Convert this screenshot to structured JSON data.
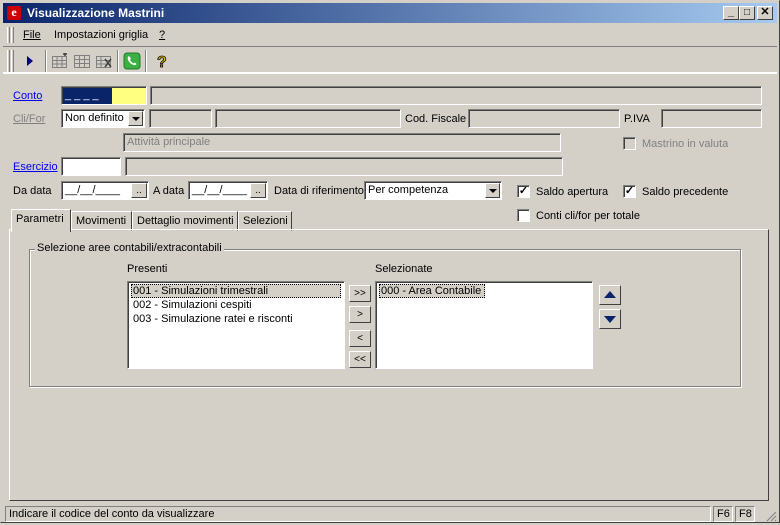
{
  "window": {
    "title": "Visualizzazione Mastrini",
    "app_icon_letter": "e",
    "controls": {
      "minimize": "_",
      "maximize": "□",
      "close": "✕"
    }
  },
  "menu": {
    "items": [
      {
        "label": "File"
      },
      {
        "label": "Impostazioni griglia"
      },
      {
        "label": "?"
      }
    ]
  },
  "toolbar": {
    "icons": [
      "play-icon",
      "grid-add-icon",
      "grid-icon",
      "grid-remove-icon",
      "phone-icon",
      "help-icon"
    ]
  },
  "form": {
    "conto": {
      "label": "Conto",
      "value": "_ _ _ _",
      "desc": ""
    },
    "clifor": {
      "label": "Cli/For",
      "selected": "Non definito",
      "code": "",
      "name": ""
    },
    "cod_fiscale": {
      "label": "Cod. Fiscale",
      "value": ""
    },
    "piva": {
      "label": "P.IVA",
      "value": ""
    },
    "attivita": {
      "placeholder": "Attività principale"
    },
    "mastrino_valuta": {
      "label": "Mastrino in valuta",
      "checked": false
    },
    "esercizio": {
      "label": "Esercizio",
      "value": "",
      "desc": ""
    },
    "da_data": {
      "label": "Da data",
      "value": "__/__/____",
      "btn": ".."
    },
    "a_data": {
      "label": "A data",
      "value": "__/__/____",
      "btn": ".."
    },
    "data_riferimento": {
      "label": "Data di riferimento",
      "selected": "Per competenza"
    },
    "saldo_apertura": {
      "label": "Saldo apertura",
      "checked": true
    },
    "saldo_precedente": {
      "label": "Saldo precedente",
      "checked": true
    },
    "conti_clifor": {
      "label": "Conti cli/for per totale",
      "checked": false
    }
  },
  "tabs": [
    {
      "label": "Parametri",
      "active": true
    },
    {
      "label": "Movimenti",
      "active": false
    },
    {
      "label": "Dettaglio movimenti",
      "active": false
    },
    {
      "label": "Selezioni",
      "active": false
    }
  ],
  "parametri": {
    "group_title": "Selezione aree contabili/extracontabili",
    "presenti": {
      "label": "Presenti",
      "items": [
        "001 - Simulazioni trimestrali",
        "002 - Simulazioni cespiti",
        "003 - Simulazione ratei e risconti"
      ],
      "selected_index": 0
    },
    "selezionate": {
      "label": "Selezionate",
      "items": [
        "000 - Area Contabile"
      ],
      "selected_index": 0
    },
    "move_buttons": [
      ">>",
      ">",
      "<",
      "<<"
    ]
  },
  "status": {
    "message": "Indicare il codice del conto da visualizzare",
    "keys": [
      "F6",
      "F8"
    ]
  },
  "colors": {
    "title_start": "#0a246a",
    "title_end": "#a6caf0",
    "face": "#d4d0c8",
    "conto_highlight": "#ffff80",
    "link": "#0000ee"
  }
}
